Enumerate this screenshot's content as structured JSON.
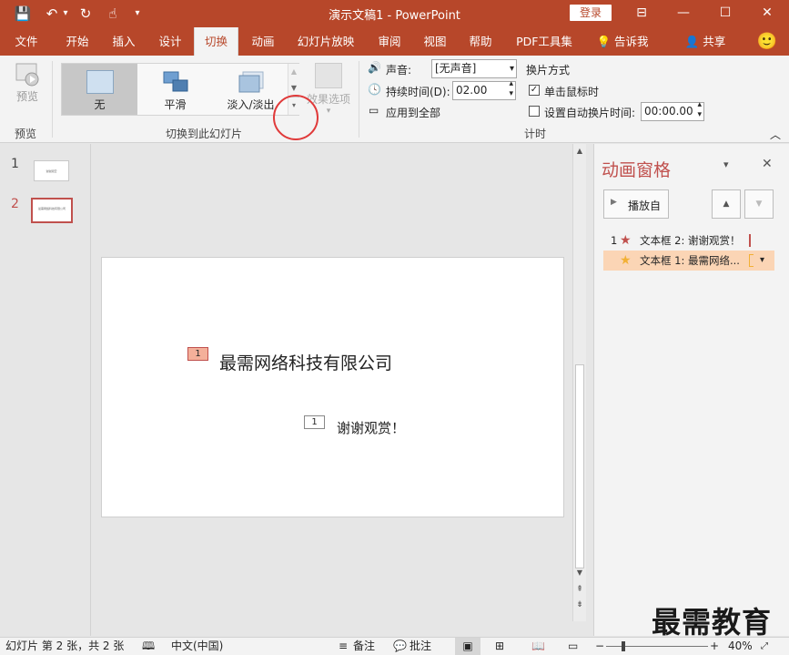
{
  "titlebar": {
    "save_icon": "💾",
    "undo_icon": "↶",
    "undo_dropdown": "▾",
    "redo_icon": "↻",
    "touch_icon": "☝",
    "customize_icon": "▾",
    "title": "演示文稿1  -  PowerPoint",
    "login": "登录",
    "ribbon_display_icon": "⊟",
    "minimize_icon": "—",
    "maximize_icon": "☐",
    "close_icon": "✕"
  },
  "tabs": [
    "文件",
    "开始",
    "插入",
    "设计",
    "切换",
    "动画",
    "幻灯片放映",
    "审阅",
    "视图",
    "帮助",
    "PDF工具集"
  ],
  "active_tab": "切换",
  "tellme": {
    "icon": "💡",
    "label": "告诉我"
  },
  "share": {
    "icon": "👤",
    "label": "共享"
  },
  "smiley": "🙂",
  "ribbon": {
    "preview": {
      "label": "预览",
      "group": "预览"
    },
    "gallery": {
      "items": [
        "无",
        "平滑",
        "淡入/淡出"
      ],
      "selected": "无",
      "scroll_up": "▲",
      "scroll_down": "▼",
      "more": "▾"
    },
    "effect_options": {
      "label": "效果选项",
      "arrow": "▾"
    },
    "group_transition": "切换到此幻灯片",
    "sound": {
      "icon": "🔊",
      "label": "声音:",
      "value": "[无声音]",
      "arrow": "▾"
    },
    "duration": {
      "icon": "🕓",
      "label": "持续时间(D):",
      "value": "02.00",
      "up": "▴",
      "down": "▾"
    },
    "apply_all": {
      "icon": "▭",
      "label": "应用到全部"
    },
    "advance": {
      "title": "换片方式",
      "on_click": {
        "label": "单击鼠标时",
        "checked": true,
        "mark": "✓"
      },
      "after": {
        "label": "设置自动换片时间:",
        "checked": false,
        "value": "00:00.00",
        "up": "▴",
        "down": "▾"
      }
    },
    "group_timing": "计时",
    "collapse": "︿"
  },
  "thumbnails": [
    {
      "num": "1",
      "text": "谢谢观赏"
    },
    {
      "num": "2",
      "text": "最需网络科技有限公司"
    }
  ],
  "slide": {
    "company": "最需网络科技有限公司",
    "thanks": "谢谢观赏！",
    "tag1": "1",
    "tag2": "1"
  },
  "scrollbar": {
    "up": "▲",
    "down": "▼",
    "prev": "⇞",
    "next": "⇟"
  },
  "anim_pane": {
    "title": "动画窗格",
    "menu_arrow": "▾",
    "close": "✕",
    "play_icon": "▶",
    "play_label": "播放自",
    "move_up": "▲",
    "move_down": "▼",
    "items": [
      {
        "num": "1",
        "star": "★",
        "label": "文本框 2: 谢谢观赏！"
      },
      {
        "num": "",
        "star": "★",
        "label": "文本框 1: 最需网络...",
        "dropdown": "▾"
      }
    ]
  },
  "statusbar": {
    "slide_info": "幻灯片 第 2 张，共 2 张",
    "spell_icon": "🕮",
    "language": "中文(中国)",
    "notes_icon": "≡",
    "notes": "备注",
    "comments_icon": "💬",
    "comments": "批注",
    "normal_icon": "▣",
    "sorter_icon": "⊞",
    "reading_icon": "📖",
    "slideshow_icon": "▭",
    "zoom_out": "−",
    "zoom_in": "+",
    "zoom": "40%",
    "zoom_fraction": 0.4
  },
  "watermark": "最需教育",
  "colors": {
    "accent": "#b7472a",
    "pane_title": "#c0504d",
    "selected_anim": "#fbd5b5",
    "star_red": "#c0504d",
    "star_gold": "#f2b035"
  }
}
